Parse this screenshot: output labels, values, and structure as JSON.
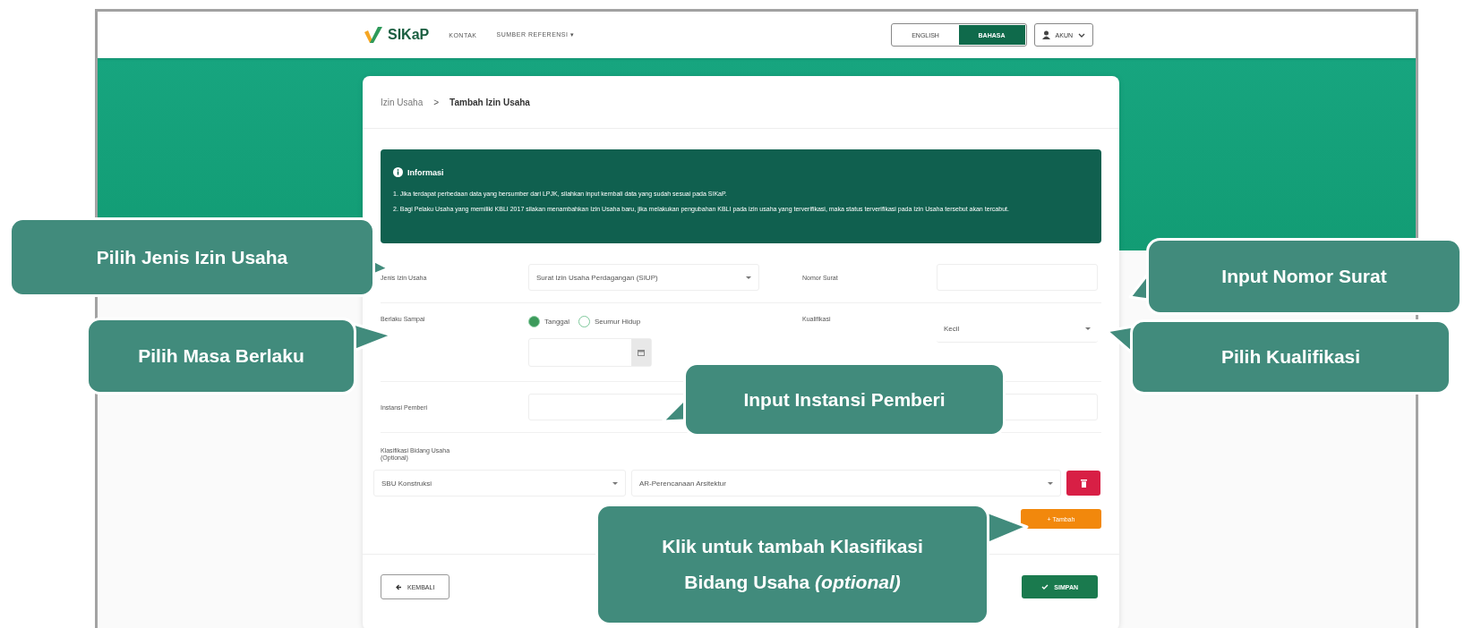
{
  "navbar": {
    "logo": "SIKaP",
    "links": [
      "KONTAK",
      "SUMBER REFERENSI ▾"
    ],
    "languages": [
      {
        "label": "ENGLISH",
        "selected": false
      },
      {
        "label": "BAHASA",
        "selected": true
      }
    ],
    "account": "AKUN"
  },
  "breadcrumb": {
    "parent": "Izin Usaha",
    "separator": ">",
    "current": "Tambah Izin Usaha"
  },
  "info": {
    "title": "Informasi",
    "items": [
      "1. Jika terdapat perbedaan data yang bersumber dari LPJK, silahkan input kembali data yang sudah sesuai pada SIKaP.",
      "2. Bagi Pelaku Usaha yang memiliki KBLI 2017 silakan menambahkan Izin Usaha baru, jika melakukan pengubahan KBLI pada izin usaha yang terverifikasi, maka status terverifikasi pada Izin Usaha tersebut akan tercabut."
    ]
  },
  "form": {
    "jenis_label": "Jenis Izin Usaha",
    "jenis_value": "Surat Izin Usaha Perdagangan (SIUP)",
    "nomor_label": "Nomor Surat",
    "berlaku_label": "Berlaku Sampai",
    "berlaku_options": [
      {
        "label": "Tanggal",
        "selected": true
      },
      {
        "label": "Seumur Hidup",
        "selected": false
      }
    ],
    "kualifikasi_label": "Kualifikasi",
    "kualifikasi_value": "Kecil",
    "instansi_label": "Instansi Pemberi",
    "klasifikasi_label": "Klasifikasi Bidang Usaha",
    "klasifikasi_note": "(Optional)",
    "klasifikasi_rows": [
      {
        "type": "SBU Konstruksi",
        "subtype": "AR-Perencanaan Arsitektur"
      }
    ],
    "add_button": "+ Tambah",
    "back_button": "KEMBALI",
    "save_button": "SIMPAN"
  },
  "callouts": [
    "Pilih Jenis Izin Usaha",
    "Pilih Masa Berlaku",
    "Input Instansi Pemberi",
    "Input Nomor Surat",
    "Pilih Kualifikasi",
    "Klik untuk tambah Klasifikasi Bidang Usaha *(optional)*"
  ]
}
